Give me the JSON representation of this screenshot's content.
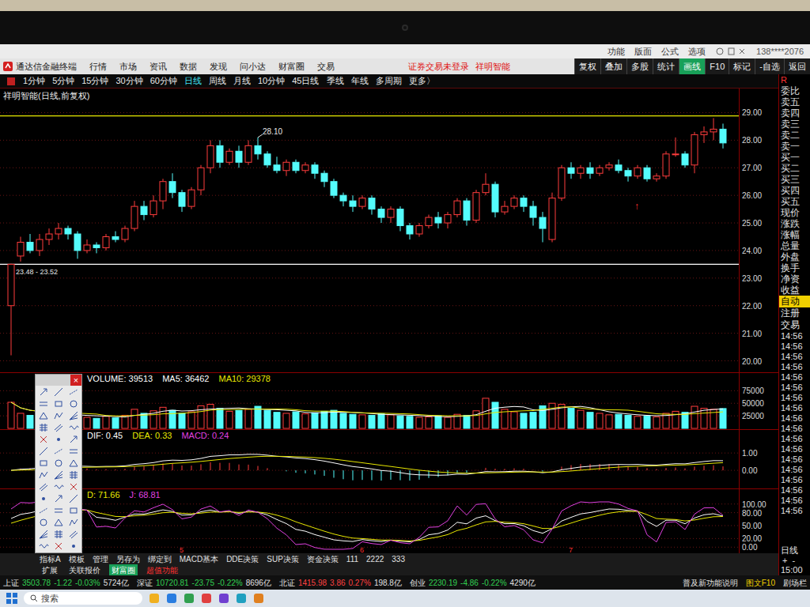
{
  "topbar": {
    "items": [
      "功能",
      "版面",
      "公式",
      "选项"
    ],
    "account": "138****2076"
  },
  "menubar": {
    "app": "通达信金融终端",
    "menus": [
      "行情",
      "市场",
      "资讯",
      "数据",
      "发现",
      "问小达",
      "财富圈",
      "交易"
    ],
    "notice": "证券交易未登录",
    "stock": "祥明智能",
    "buttons": [
      {
        "label": "复权",
        "selected": false
      },
      {
        "label": "叠加",
        "selected": false
      },
      {
        "label": "多股",
        "selected": false
      },
      {
        "label": "统计",
        "selected": false
      },
      {
        "label": "画线",
        "selected": true
      },
      {
        "label": "F10",
        "selected": false
      },
      {
        "label": "标记",
        "selected": false
      },
      {
        "label": "-自选",
        "selected": false
      },
      {
        "label": "返回",
        "selected": false
      }
    ]
  },
  "periods": [
    {
      "label": "1分钟",
      "selected": false
    },
    {
      "label": "5分钟",
      "selected": false
    },
    {
      "label": "15分钟",
      "selected": false
    },
    {
      "label": "30分钟",
      "selected": false
    },
    {
      "label": "60分钟",
      "selected": false
    },
    {
      "label": "日线",
      "selected": true
    },
    {
      "label": "周线",
      "selected": false
    },
    {
      "label": "月线",
      "selected": false
    },
    {
      "label": "10分钟",
      "selected": false
    },
    {
      "label": "45日线",
      "selected": false
    },
    {
      "label": "季线",
      "selected": false
    },
    {
      "label": "年线",
      "selected": false
    },
    {
      "label": "多周期",
      "selected": false
    },
    {
      "label": "更多〉",
      "selected": false
    }
  ],
  "chart": {
    "title": "祥明智能(日线,前复权)",
    "price_ticks": [
      "29.00",
      "28.00",
      "27.00",
      "26.00",
      "25.00",
      "24.00",
      "23.00",
      "22.00",
      "21.00",
      "20.00"
    ],
    "peak_label": {
      "text": "28.10",
      "index": 26
    },
    "range_label": "23.48 - 23.52",
    "lines": [
      {
        "price": 28.88,
        "color": "#e8e800"
      },
      {
        "price": 23.5,
        "color": "#ffffff"
      }
    ],
    "marker": {
      "glyph": "↑",
      "index": 66,
      "price": 25.9
    },
    "month_marks": [
      {
        "label": "5",
        "index": 18
      },
      {
        "label": "6",
        "index": 37
      },
      {
        "label": "7",
        "index": 59
      }
    ],
    "candles": [
      [
        22.0,
        23.52,
        20.2,
        23.5,
        52000
      ],
      [
        23.8,
        24.5,
        23.6,
        24.3,
        30000
      ],
      [
        24.3,
        24.6,
        23.9,
        24.0,
        26000
      ],
      [
        24.0,
        24.6,
        23.8,
        24.4,
        28000
      ],
      [
        24.4,
        24.8,
        24.2,
        24.6,
        24000
      ],
      [
        24.6,
        25.0,
        24.4,
        24.8,
        27000
      ],
      [
        24.8,
        24.9,
        24.4,
        24.6,
        25000
      ],
      [
        24.6,
        24.7,
        23.7,
        24.0,
        31000
      ],
      [
        24.0,
        24.4,
        23.9,
        24.2,
        22000
      ],
      [
        24.2,
        24.3,
        23.9,
        24.1,
        20000
      ],
      [
        24.1,
        24.6,
        24.0,
        24.5,
        24000
      ],
      [
        24.5,
        24.7,
        24.3,
        24.4,
        21000
      ],
      [
        24.4,
        24.9,
        24.3,
        24.8,
        26000
      ],
      [
        24.8,
        25.8,
        24.7,
        25.6,
        38000
      ],
      [
        25.6,
        25.8,
        25.1,
        25.3,
        30000
      ],
      [
        25.3,
        26.0,
        25.2,
        25.8,
        35000
      ],
      [
        25.8,
        26.6,
        25.5,
        26.5,
        42000
      ],
      [
        26.5,
        26.8,
        25.9,
        26.1,
        36000
      ],
      [
        26.1,
        26.2,
        25.4,
        25.6,
        30000
      ],
      [
        25.6,
        26.3,
        25.5,
        26.2,
        33000
      ],
      [
        26.2,
        27.1,
        26.0,
        27.0,
        45000
      ],
      [
        27.0,
        28.0,
        26.8,
        27.8,
        48000
      ],
      [
        27.8,
        28.0,
        27.0,
        27.2,
        40000
      ],
      [
        27.2,
        27.7,
        27.1,
        27.6,
        34000
      ],
      [
        27.6,
        27.8,
        27.0,
        27.2,
        36000
      ],
      [
        27.2,
        28.0,
        27.1,
        27.8,
        38000
      ],
      [
        27.8,
        28.1,
        27.3,
        27.5,
        44000
      ],
      [
        27.5,
        27.6,
        27.0,
        27.1,
        36000
      ],
      [
        27.1,
        27.4,
        26.8,
        26.9,
        32000
      ],
      [
        26.9,
        27.3,
        26.7,
        27.2,
        30000
      ],
      [
        27.2,
        27.3,
        26.8,
        26.9,
        33000
      ],
      [
        26.9,
        27.2,
        26.8,
        27.1,
        29000
      ],
      [
        27.1,
        27.2,
        26.6,
        26.8,
        31000
      ],
      [
        26.8,
        26.9,
        26.3,
        26.5,
        34000
      ],
      [
        26.5,
        26.6,
        25.9,
        26.0,
        36000
      ],
      [
        26.0,
        26.1,
        25.6,
        25.8,
        30000
      ],
      [
        25.8,
        26.0,
        25.4,
        25.6,
        28000
      ],
      [
        25.6,
        26.0,
        25.5,
        25.9,
        27000
      ],
      [
        25.9,
        26.0,
        25.3,
        25.5,
        26000
      ],
      [
        25.5,
        25.6,
        25.0,
        25.2,
        29000
      ],
      [
        25.2,
        25.6,
        25.0,
        25.5,
        27000
      ],
      [
        25.5,
        25.6,
        24.7,
        24.9,
        25000
      ],
      [
        24.9,
        25.0,
        24.4,
        24.6,
        24000
      ],
      [
        24.6,
        25.0,
        24.5,
        24.9,
        22000
      ],
      [
        24.9,
        25.3,
        24.8,
        25.2,
        23000
      ],
      [
        25.2,
        25.4,
        24.8,
        25.0,
        25000
      ],
      [
        25.0,
        25.4,
        24.8,
        25.3,
        22000
      ],
      [
        25.3,
        25.9,
        25.2,
        25.8,
        28000
      ],
      [
        25.8,
        25.9,
        24.9,
        25.1,
        26000
      ],
      [
        25.1,
        26.2,
        25.0,
        26.1,
        35000
      ],
      [
        26.1,
        26.8,
        26.0,
        26.4,
        60000
      ],
      [
        26.4,
        26.5,
        25.2,
        25.4,
        52000
      ],
      [
        25.4,
        25.8,
        25.3,
        25.6,
        38000
      ],
      [
        25.6,
        26.0,
        25.5,
        25.9,
        33000
      ],
      [
        25.9,
        26.0,
        25.4,
        25.6,
        30000
      ],
      [
        25.6,
        25.8,
        24.9,
        25.2,
        32000
      ],
      [
        25.2,
        25.4,
        24.3,
        24.8,
        45000
      ],
      [
        24.4,
        26.1,
        24.3,
        25.9,
        50000
      ],
      [
        25.9,
        27.1,
        25.8,
        27.0,
        48000
      ],
      [
        27.0,
        27.2,
        26.6,
        26.8,
        40000
      ],
      [
        26.8,
        27.1,
        26.6,
        27.0,
        36000
      ],
      [
        27.0,
        27.2,
        26.6,
        26.8,
        32000
      ],
      [
        26.8,
        27.1,
        26.7,
        27.0,
        30000
      ],
      [
        27.0,
        27.2,
        26.9,
        27.1,
        27000
      ],
      [
        27.1,
        27.3,
        26.8,
        26.9,
        28000
      ],
      [
        26.9,
        27.0,
        26.5,
        26.7,
        26000
      ],
      [
        26.7,
        27.1,
        26.6,
        27.0,
        24000
      ],
      [
        27.0,
        27.1,
        26.5,
        26.6,
        25000
      ],
      [
        26.6,
        26.8,
        26.5,
        26.7,
        23000
      ],
      [
        26.7,
        27.6,
        26.6,
        27.5,
        30000
      ],
      [
        27.5,
        28.1,
        27.4,
        27.5,
        34000
      ],
      [
        27.5,
        27.6,
        27.0,
        27.1,
        32000
      ],
      [
        27.1,
        28.3,
        26.8,
        28.2,
        44000
      ],
      [
        28.2,
        28.5,
        27.9,
        28.3,
        40000
      ],
      [
        28.3,
        28.8,
        28.0,
        28.4,
        38000
      ],
      [
        28.4,
        28.6,
        27.7,
        27.9,
        39513
      ]
    ]
  },
  "volume": {
    "legend": [
      {
        "label": "VOLUME: 39513",
        "color": "#ffffff"
      },
      {
        "label": "MA5: 36462",
        "color": "#ffffff"
      },
      {
        "label": "MA10: 29378",
        "color": "#e8e800"
      }
    ],
    "ticks": [
      "75000",
      "50000",
      "25000"
    ]
  },
  "macd": {
    "legend": [
      {
        "label": "DIF: 0.45",
        "color": "#ffffff"
      },
      {
        "label": "DEA: 0.33",
        "color": "#e8e800"
      },
      {
        "label": "MACD: 0.24",
        "color": "#e040e0"
      }
    ],
    "ticks": [
      "1.00",
      "0.00"
    ]
  },
  "kdj": {
    "legend": [
      {
        "label": "D: 71.66",
        "color": "#e8e800"
      },
      {
        "label": "J: 68.81",
        "color": "#e040e0"
      }
    ],
    "ticks": [
      "100.00",
      "80.00",
      "50.00",
      "20.00",
      "0.00"
    ]
  },
  "drawing_toolbar": {
    "close": "×"
  },
  "bottom_tabs": {
    "row1": [
      "指标A",
      "模板",
      "管理",
      "另存为",
      "绑定到",
      "MACD基本",
      "DDE决策",
      "SUP决策",
      "资金决策",
      "111",
      "2222",
      "333"
    ],
    "row2": [
      {
        "label": "扩展",
        "kind": "tab"
      },
      {
        "label": "关联报价",
        "kind": "tab"
      },
      {
        "label": "财富圈",
        "kind": "active"
      },
      {
        "label": "超值功能",
        "kind": "promo"
      }
    ]
  },
  "quote_panel": {
    "corner": "R",
    "labels": [
      "委比",
      "卖五",
      "卖四",
      "卖三",
      "卖二",
      "卖一",
      "买一",
      "买二",
      "买三",
      "买四",
      "买五",
      "现价",
      "涨跌",
      "涨幅",
      "总量",
      "外盘",
      "换手",
      "净资",
      "收益"
    ],
    "actions": [
      {
        "label": "自动",
        "selected": true
      },
      {
        "label": "注册",
        "selected": false
      },
      {
        "label": "交易",
        "selected": false
      }
    ],
    "times": [
      "14:56",
      "14:56",
      "14:56",
      "14:56",
      "14:56",
      "14:56",
      "14:56",
      "14:56",
      "14:56",
      "14:56",
      "14:56",
      "14:56",
      "14:56",
      "14:56",
      "14:56",
      "14:56",
      "14:56",
      "14:56"
    ],
    "period": "日线",
    "zoom": [
      "+",
      "-"
    ],
    "close_time": "15:00"
  },
  "status_bar": {
    "indices": [
      {
        "name": "上证",
        "value": "3503.78",
        "change": "-1.22",
        "pct": "-0.03%",
        "amount": "5724亿",
        "up": false
      },
      {
        "name": "深证",
        "value": "10720.81",
        "change": "-23.75",
        "pct": "-0.22%",
        "amount": "8696亿",
        "up": false
      },
      {
        "name": "北证",
        "value": "1415.98",
        "change": "3.86",
        "pct": "0.27%",
        "amount": "198.8亿",
        "up": true
      },
      {
        "name": "创业",
        "value": "2230.19",
        "change": "-4.86",
        "pct": "-0.22%",
        "amount": "4290亿",
        "up": false
      }
    ],
    "links": [
      "普及新功能说明",
      "图文F10",
      "剧场栏"
    ]
  },
  "taskbar": {
    "search": "搜索"
  }
}
